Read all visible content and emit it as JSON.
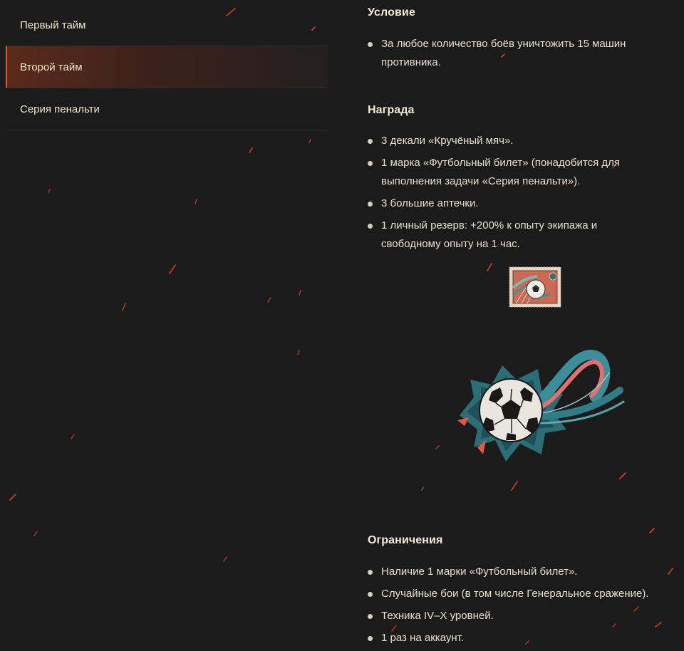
{
  "nav": {
    "items": [
      {
        "label": "Первый тайм",
        "active": false
      },
      {
        "label": "Второй тайм",
        "active": true
      },
      {
        "label": "Серия пенальти",
        "active": false
      }
    ]
  },
  "condition": {
    "title": "Условие",
    "items": [
      {
        "lines": [
          "За любое количество боёв уничтожить 15 машин",
          "противника."
        ]
      }
    ]
  },
  "reward": {
    "title": "Награда",
    "items": [
      {
        "lines": [
          "3 декали «Кручёный мяч»."
        ]
      },
      {
        "lines": [
          "1 марка «Футбольный билет» (понадобится для",
          "выполнения задачи «Серия пенальти»)."
        ]
      },
      {
        "lines": [
          "3 большие аптечки."
        ]
      },
      {
        "lines": [
          "1 личный резерв: +200% к опыту экипажа и",
          "свободному опыту на 1 час."
        ]
      }
    ],
    "images": [
      "football-ticket-stamp",
      "curved-ball-decal"
    ]
  },
  "restrictions": {
    "title": "Ограничения",
    "items": [
      {
        "lines": [
          "Наличие 1 марки «Футбольный билет»."
        ]
      },
      {
        "lines": [
          "Случайные бои (в том числе Генеральное сражение)."
        ]
      },
      {
        "lines": [
          "Техника IV–X уровней."
        ]
      },
      {
        "lines": [
          "1 раз на аккаунт."
        ]
      }
    ]
  },
  "colors": {
    "background": "#1c1b1c",
    "accent": "#e2582f",
    "text": "#e6e0cf"
  }
}
